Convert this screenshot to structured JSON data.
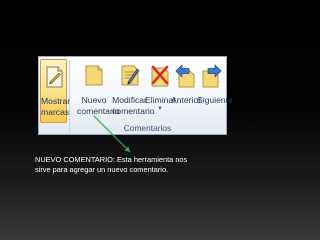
{
  "ribbon": {
    "group_label": "Comentarios",
    "buttons": {
      "mostrar": {
        "line1": "Mostrar",
        "line2": "marcas",
        "icon": "show-markup-icon"
      },
      "nuevo": {
        "line1": "Nuevo",
        "line2": "comentario",
        "icon": "new-comment-icon"
      },
      "modificar": {
        "line1": "Modificar",
        "line2": "comentario",
        "icon": "edit-comment-icon"
      },
      "eliminar": {
        "line1": "Eliminar",
        "caret": "▼",
        "icon": "delete-comment-icon"
      },
      "anterior": {
        "line1": "Anterior",
        "icon": "previous-comment-icon"
      },
      "siguiente": {
        "line1": "Siguiente",
        "icon": "next-comment-icon"
      }
    }
  },
  "caption": {
    "line1": "NUEVO COMENTARIO: Esta herramienta nos",
    "line2": "sirve para agregar un nuevo comentario."
  },
  "colors": {
    "arrow": "#2fa84f",
    "label_text": "#1e395b",
    "note_yellow": "#f3d97a",
    "delete_red": "#d2302b",
    "nav_blue": "#3a78c9"
  }
}
